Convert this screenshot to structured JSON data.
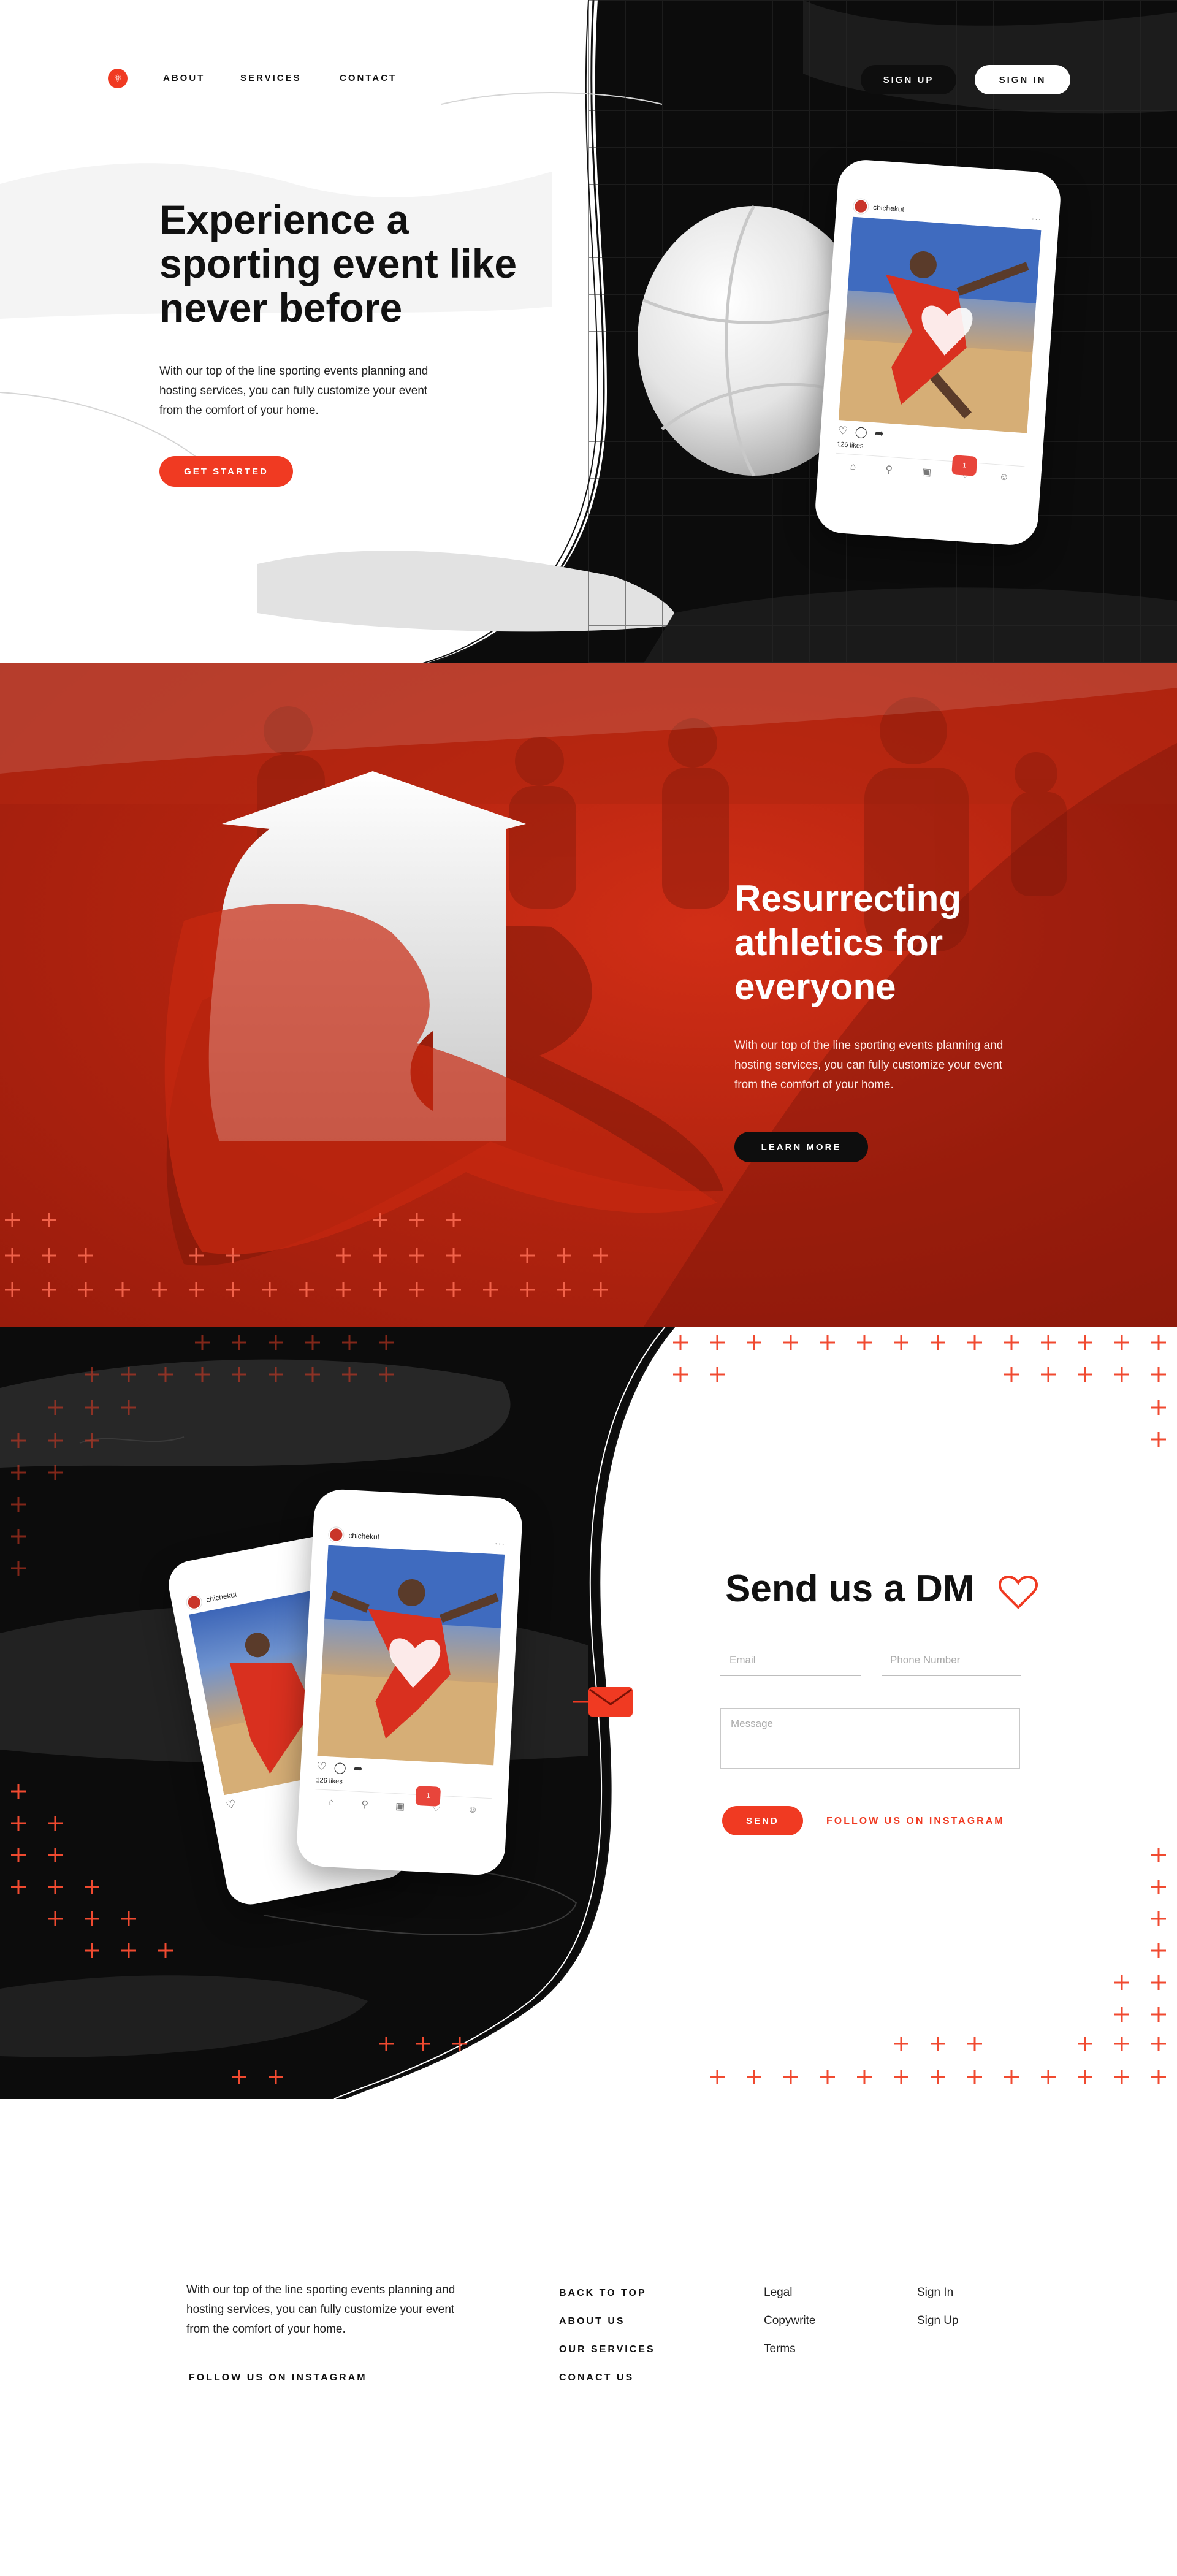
{
  "colors": {
    "accent": "#f03a22",
    "dark": "#0e0e0e",
    "light": "#ffffff"
  },
  "brand": {
    "logo_icon": "brand-logo-icon"
  },
  "nav": {
    "links": [
      "ABOUT",
      "SERVICES",
      "CONTACT"
    ],
    "sign_up": "SIGN UP",
    "sign_in": "SIGN IN"
  },
  "hero": {
    "title": "Experience a sporting event like never before",
    "text": "With our top of the line sporting events planning and hosting services, you can fully customize your event from the comfort of your home.",
    "cta": "GET STARTED"
  },
  "phone": {
    "username": "chichekut",
    "likes": "126 likes",
    "notify_count": "1"
  },
  "section2": {
    "title": "Resurrecting athletics for everyone",
    "text": "With our top of the line sporting events planning and hosting services, you can fully customize your event from the comfort of your home.",
    "cta": "LEARN MORE"
  },
  "contact": {
    "title": "Send us a DM",
    "email_placeholder": "Email",
    "phone_placeholder": "Phone Number",
    "message_placeholder": "Message",
    "send": "SEND",
    "follow": "FOLLOW US ON INSTAGRAM"
  },
  "footer": {
    "text": "With our top of the line sporting events planning and hosting services, you can fully customize your event from the comfort of your home.",
    "follow": "FOLLOW US ON INSTAGRAM",
    "col1": [
      "BACK TO TOP",
      "ABOUT US",
      "OUR SERVICES",
      "CONACT US"
    ],
    "col2": [
      "Legal",
      "Copywrite",
      "Terms"
    ],
    "col3": [
      "Sign In",
      "Sign Up"
    ]
  }
}
